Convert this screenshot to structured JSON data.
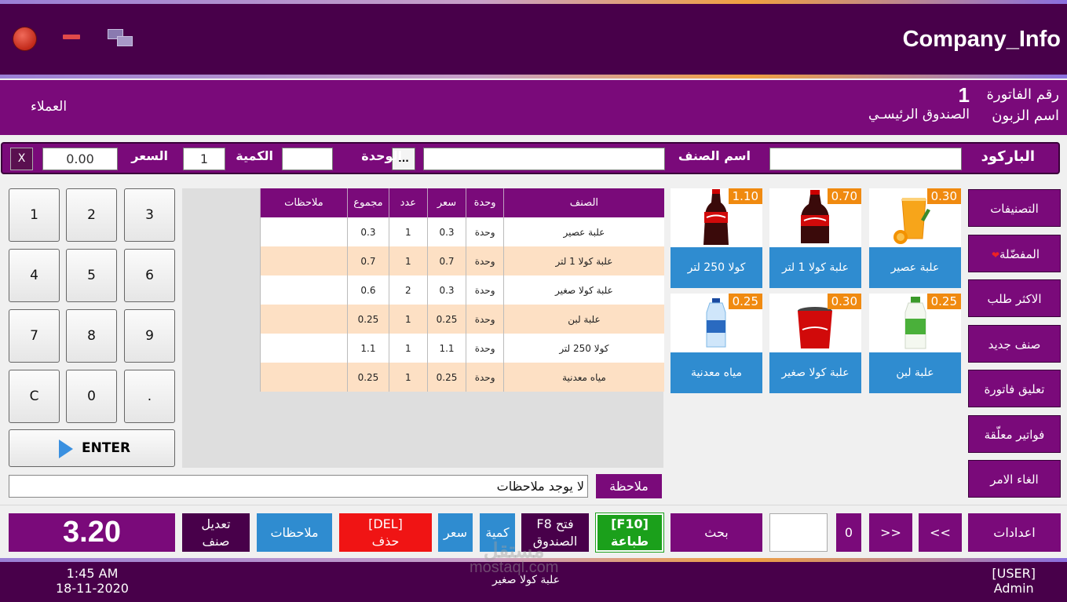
{
  "window": {
    "title": "Company_Info"
  },
  "invoice": {
    "number_label": "رقم الفاتورة",
    "number": "1",
    "customer_label": "اسم الزبون",
    "customer": "الصندوق الرئيسـي",
    "customers_link": "العملاء"
  },
  "entry": {
    "barcode_label": "الباركود",
    "barcode_value": "",
    "item_name_label": "اسم الصنف",
    "item_name_value": "",
    "unit_label": "الوحدة",
    "unit_value": "",
    "unit_picker": "...",
    "qty_label": "الكمية",
    "qty_value": "1",
    "price_label": "السعر",
    "price_value": "0.00",
    "clear": "X"
  },
  "keypad": {
    "keys": [
      "1",
      "2",
      "3",
      "4",
      "5",
      "6",
      "7",
      "8",
      "9",
      "C",
      "0",
      "."
    ],
    "enter": "ENTER"
  },
  "table": {
    "columns": [
      "الصنف",
      "وحدة",
      "سعر",
      "عدد",
      "مجموع",
      "ملاحظات"
    ],
    "rows": [
      {
        "item": "علبة عصير",
        "unit": "وحدة",
        "price": "0.3",
        "qty": "1",
        "total": "0.3",
        "notes": ""
      },
      {
        "item": "علبة كولا 1 لتر",
        "unit": "وحدة",
        "price": "0.7",
        "qty": "1",
        "total": "0.7",
        "notes": ""
      },
      {
        "item": "علبة كولا صغير",
        "unit": "وحدة",
        "price": "0.3",
        "qty": "2",
        "total": "0.6",
        "notes": ""
      },
      {
        "item": "علبة لبن",
        "unit": "وحدة",
        "price": "0.25",
        "qty": "1",
        "total": "0.25",
        "notes": ""
      },
      {
        "item": "كولا 250 لتر",
        "unit": "وحدة",
        "price": "1.1",
        "qty": "1",
        "total": "1.1",
        "notes": ""
      },
      {
        "item": "مياه معدنية",
        "unit": "وحدة",
        "price": "0.25",
        "qty": "1",
        "total": "0.25",
        "notes": ""
      }
    ]
  },
  "products": [
    {
      "name": "علبة عصير",
      "price": "0.30",
      "icon": "juice-glass-icon"
    },
    {
      "name": "علبة كولا 1 لتر",
      "price": "0.70",
      "icon": "cola-bottle-icon"
    },
    {
      "name": "كولا 250 لتر",
      "price": "1.10",
      "icon": "cola-bottle-icon"
    },
    {
      "name": "علبة لبن",
      "price": "0.25",
      "icon": "laban-bottle-icon"
    },
    {
      "name": "علبة كولا صغير",
      "price": "0.30",
      "icon": "cola-cup-icon"
    },
    {
      "name": "مياه معدنية",
      "price": "0.25",
      "icon": "water-bottle-icon"
    }
  ],
  "categories": [
    {
      "label": "التصنيفات"
    },
    {
      "label": "المفضّلة"
    },
    {
      "label": "الاكثر طلب"
    },
    {
      "label": "صنف جديد"
    },
    {
      "label": "تعليق فاتورة"
    },
    {
      "label": "فواتير معلّقة"
    },
    {
      "label": "الغاء الامر"
    }
  ],
  "notes": {
    "label": "ملاحظة",
    "value": "لا يوجد ملاحظات"
  },
  "toolbar": {
    "total": "3.20",
    "edit_item_1": "تعديل",
    "edit_item_2": "صنف",
    "notes": "ملاحظات",
    "delete_1": "[DEL]",
    "delete_2": "حذف",
    "price": "سعر",
    "qty": "كمية",
    "open_drawer_1": "فتح F8",
    "open_drawer_2": "الصندوق",
    "print_1": "[F10]",
    "print_2": "طباعة",
    "search": "بحث",
    "search_value": "",
    "page": "0",
    "prev": "<<",
    "next": ">>",
    "settings": "اعدادات"
  },
  "status": {
    "time": "1:45 AM",
    "date": "18-11-2020",
    "last_item": "علبة كولا صغير",
    "user_role": "[USER]",
    "user_name": "Admin",
    "watermark_ar": "مستقل",
    "watermark_en": "mostaql.com"
  },
  "colors": {
    "title_bar": "#48004a",
    "primary": "#7a0a7a",
    "product_label": "#2f8cd0",
    "price_badge": "#f08a10",
    "row_alt": "#fde0c4",
    "delete": "#f01414",
    "print": "#1ba01b"
  }
}
